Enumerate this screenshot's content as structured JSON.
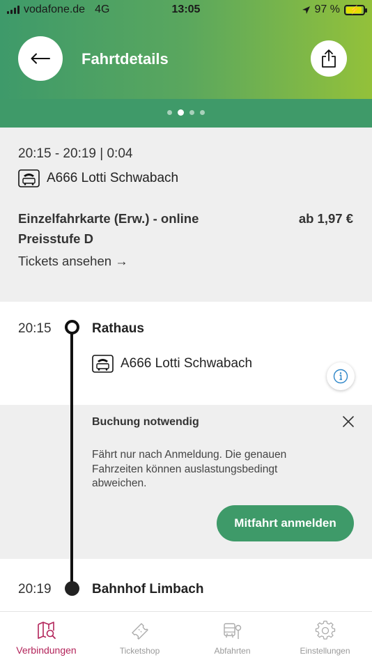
{
  "status_bar": {
    "carrier": "vodafone.de",
    "network": "4G",
    "time": "13:05",
    "battery": "97 %"
  },
  "header": {
    "title": "Fahrtdetails",
    "back_icon": "arrow-left-icon",
    "share_icon": "share-icon",
    "pager": {
      "pages": 4,
      "active_index": 1
    }
  },
  "summary": {
    "time_range": "20:15 - 20:19 | 0:04",
    "line": "A666 Lotti Schwabach",
    "ticket_name_line1": "Einzelfahrkarte (Erw.) - online",
    "ticket_name_line2": "Preisstufe D",
    "price": "ab 1,97 €",
    "tickets_link": "Tickets ansehen →"
  },
  "journey": {
    "departure": {
      "time": "20:15",
      "stop": "Rathaus"
    },
    "leg_line": "A666 Lotti Schwabach",
    "notice": {
      "title": "Buchung notwendig",
      "text": "Fährt nur nach Anmeldung. Die genauen Fahrzeiten können auslastungsbedingt abweichen.",
      "button": "Mitfahrt anmelden"
    },
    "arrival": {
      "time": "20:19",
      "stop": "Bahnhof Limbach"
    }
  },
  "tabbar": {
    "active": "connections",
    "items": [
      {
        "label": "Verbindungen",
        "icon": "map-search-icon"
      },
      {
        "label": "Ticketshop",
        "icon": "ticket-icon"
      },
      {
        "label": "Abfahrten",
        "icon": "bus-stop-icon"
      },
      {
        "label": "Einstellungen",
        "icon": "gear-icon"
      }
    ]
  },
  "colors": {
    "brand_green": "#3e9a69",
    "gradient_end": "#93c13a",
    "active_tab": "#b3245a"
  }
}
